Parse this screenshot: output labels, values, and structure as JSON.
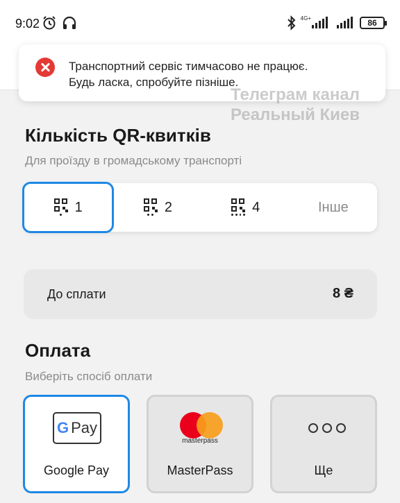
{
  "status_bar": {
    "time": "9:02",
    "network": "4G+",
    "battery": "86"
  },
  "toast": {
    "line1": "Транспортний сервіс тимчасово не працює.",
    "line2": "Будь ласка, спробуйте пізніше."
  },
  "watermark": {
    "line1": "Телеграм канал",
    "line2": "Реальный Киев"
  },
  "quantity": {
    "title": "Кількість QR-квитків",
    "subtitle": "Для проїзду в громадському транспорті",
    "options": [
      {
        "label": "1",
        "selected": true
      },
      {
        "label": "2",
        "selected": false
      },
      {
        "label": "4",
        "selected": false
      },
      {
        "label": "Інше",
        "selected": false
      }
    ]
  },
  "total": {
    "label": "До сплати",
    "amount": "8 ₴"
  },
  "payment": {
    "title": "Оплата",
    "subtitle": "Виберіть спосіб оплати",
    "methods": [
      {
        "label": "Google Pay",
        "logo_text": "Pay",
        "selected": true
      },
      {
        "label": "MasterPass",
        "logo_text": "masterpass",
        "selected": false
      },
      {
        "label": "Ще",
        "selected": false
      }
    ]
  },
  "colors": {
    "accent": "#1e88e5",
    "error": "#e53935"
  }
}
